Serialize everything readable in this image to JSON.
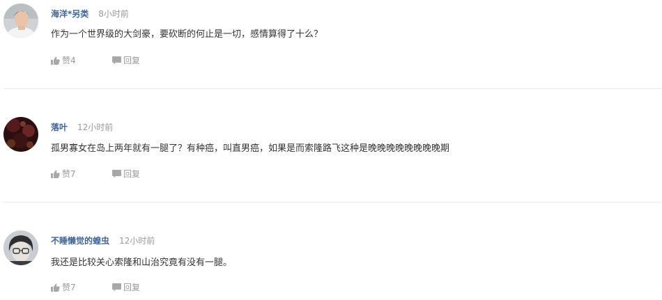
{
  "colors": {
    "username": "#406599",
    "muted": "#999999",
    "text": "#333333",
    "divider": "#e9e9e9"
  },
  "comments": [
    {
      "avatar": "avatar-man-white-shirt",
      "username": "海洋*另类",
      "time": "8小时前",
      "text": "作为一个世界级的大剑豪，要砍断的何止是一切，感情算得了十么？",
      "like_label": "赞4",
      "reply_label": "回复"
    },
    {
      "avatar": "avatar-dark-red-bokeh",
      "username": "落叶",
      "time": "12小时前",
      "text": "孤男寡女在岛上两年就有一腿了？有种癌，叫直男癌，如果是而索隆路飞这种是晚晚晚晚晚晚晚晚期",
      "like_label": "赞7",
      "reply_label": "回复"
    },
    {
      "avatar": "avatar-anime-glasses",
      "username": "不睡懒觉的蝗虫",
      "time": "12小时前",
      "text": "我还是比较关心索隆和山治究竟有没有一腿。",
      "like_label": "赞7",
      "reply_label": "回复"
    }
  ],
  "icons": {
    "like": "thumbs-up-icon",
    "reply": "speech-bubble-icon"
  }
}
